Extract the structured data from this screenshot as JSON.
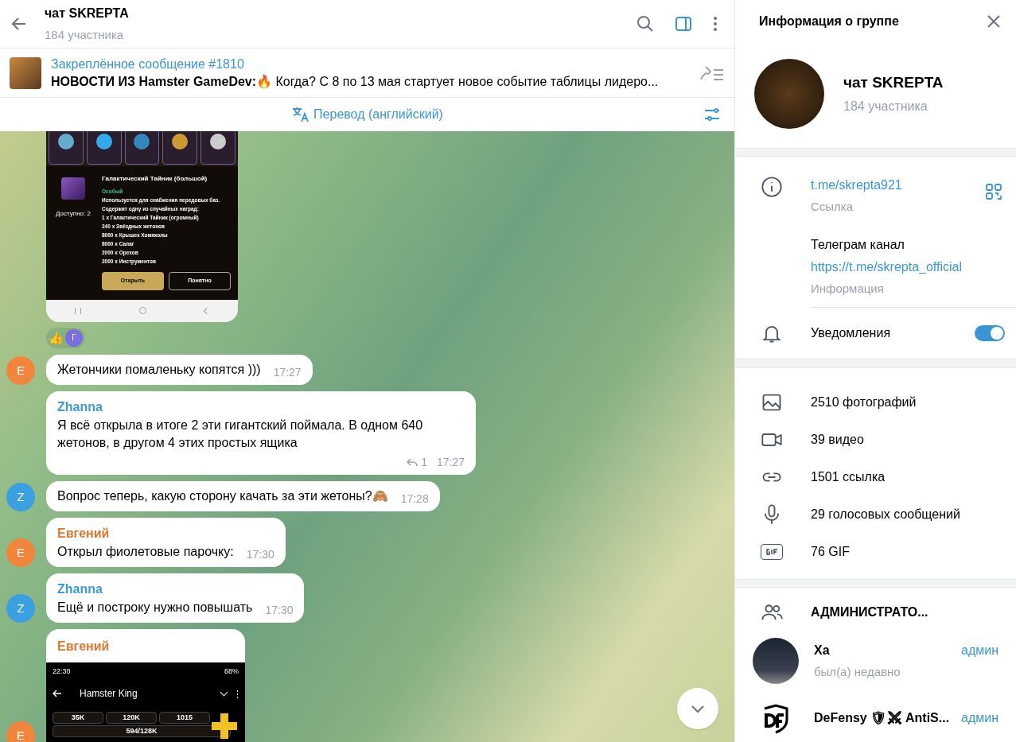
{
  "chat_header": {
    "title": "чат SKREPTA",
    "subtitle": "184 участника"
  },
  "pinned": {
    "title": "Закреплённое сообщение #1810",
    "bold": "НОВОСТИ ИЗ Hamster GameDev:",
    "text": "🔥 Когда? С 8 по 13 мая стартует новое событие таблицы лидеро..."
  },
  "translate_bar": {
    "label": "Перевод (английский)"
  },
  "messages": [
    {
      "kind": "game_item",
      "item": {
        "available": "Доступно: 2",
        "title": "Галактический Тайник (большой)",
        "rarity": "Особый",
        "lines": [
          "Используется для снабжения передовых баз.",
          "Содержит одну из случайных наград:",
          "1 x Галактический Тайник (огромный)",
          "240 x Звёздных жетонов",
          "8000 x Крышек Хомяколы",
          "8000 x Салаг",
          "2000 x Орехов",
          "2000 x Инструментов"
        ],
        "buttons": [
          "Открыть",
          "Понятно"
        ]
      },
      "reactions": [
        {
          "kind": "emoji",
          "text": "👍"
        },
        {
          "kind": "avatar",
          "text": "Г"
        }
      ]
    },
    {
      "kind": "text",
      "text": "Жетончики помаленьку копятся )))",
      "time": "17:27",
      "avatar": {
        "letter": "E",
        "color": "#f2853c"
      }
    },
    {
      "kind": "text",
      "sender": {
        "name": "Zhanna",
        "color": "#3a9ad9"
      },
      "text": "Я всё открыла в итоге 2 эти гигантский поймала. В одном 640 жетонов, в другом 4 этих простых ящика",
      "replies": "1",
      "time": "17:27"
    },
    {
      "kind": "text",
      "text": "Вопрос теперь, какую сторону качать за эти жетоны?🙈",
      "time": "17:28",
      "avatar": {
        "letter": "Z",
        "color": "#3aa0e0"
      }
    },
    {
      "kind": "text",
      "sender": {
        "name": "Евгений",
        "color": "#e0762e"
      },
      "text": "Открыл фиолетовые парочку:",
      "time": "17:30",
      "avatar": {
        "letter": "E",
        "color": "#f2853c"
      }
    },
    {
      "kind": "text",
      "sender": {
        "name": "Zhanna",
        "color": "#3a9ad9"
      },
      "text": "Ещё и построку нужно повышать",
      "time": "17:30",
      "avatar": {
        "letter": "Z",
        "color": "#3aa0e0"
      }
    },
    {
      "kind": "game_screen",
      "sender": {
        "name": "Евгений",
        "color": "#e0762e"
      },
      "avatar": {
        "letter": "E",
        "color": "#f2853c"
      },
      "screen": {
        "clock": "22:30",
        "battery": "68%",
        "title": "Hamster King",
        "resources": [
          "35K",
          "120K",
          "1015"
        ],
        "energy": "594/128K"
      }
    }
  ],
  "info_panel": {
    "title": "Информация о группе",
    "group_name": "чат SKREPTA",
    "group_members": "184 участника",
    "link": {
      "value": "t.me/skrepta921",
      "label": "Ссылка"
    },
    "description": {
      "lines": [
        "Телеграм канал",
        "https://t.me/skrepta_official"
      ],
      "label": "Информация"
    },
    "notifications": {
      "label": "Уведомления",
      "on": true
    },
    "media": [
      {
        "kind": "photo",
        "label": "2510 фотографий"
      },
      {
        "kind": "video",
        "label": "39 видео"
      },
      {
        "kind": "link",
        "label": "1501 ссылка"
      },
      {
        "kind": "voice",
        "label": "29 голосовых сообщений"
      },
      {
        "kind": "gif",
        "label": "76 GIF"
      }
    ],
    "admins_title": "АДМИНИСТРАТО...",
    "admins": [
      {
        "kind": "photo",
        "name": "Xa",
        "role": "админ",
        "status": "был(а) недавно"
      },
      {
        "kind": "logo",
        "name": "DeFensy 🛡⚔ AntiS...",
        "role": "админ"
      }
    ]
  }
}
